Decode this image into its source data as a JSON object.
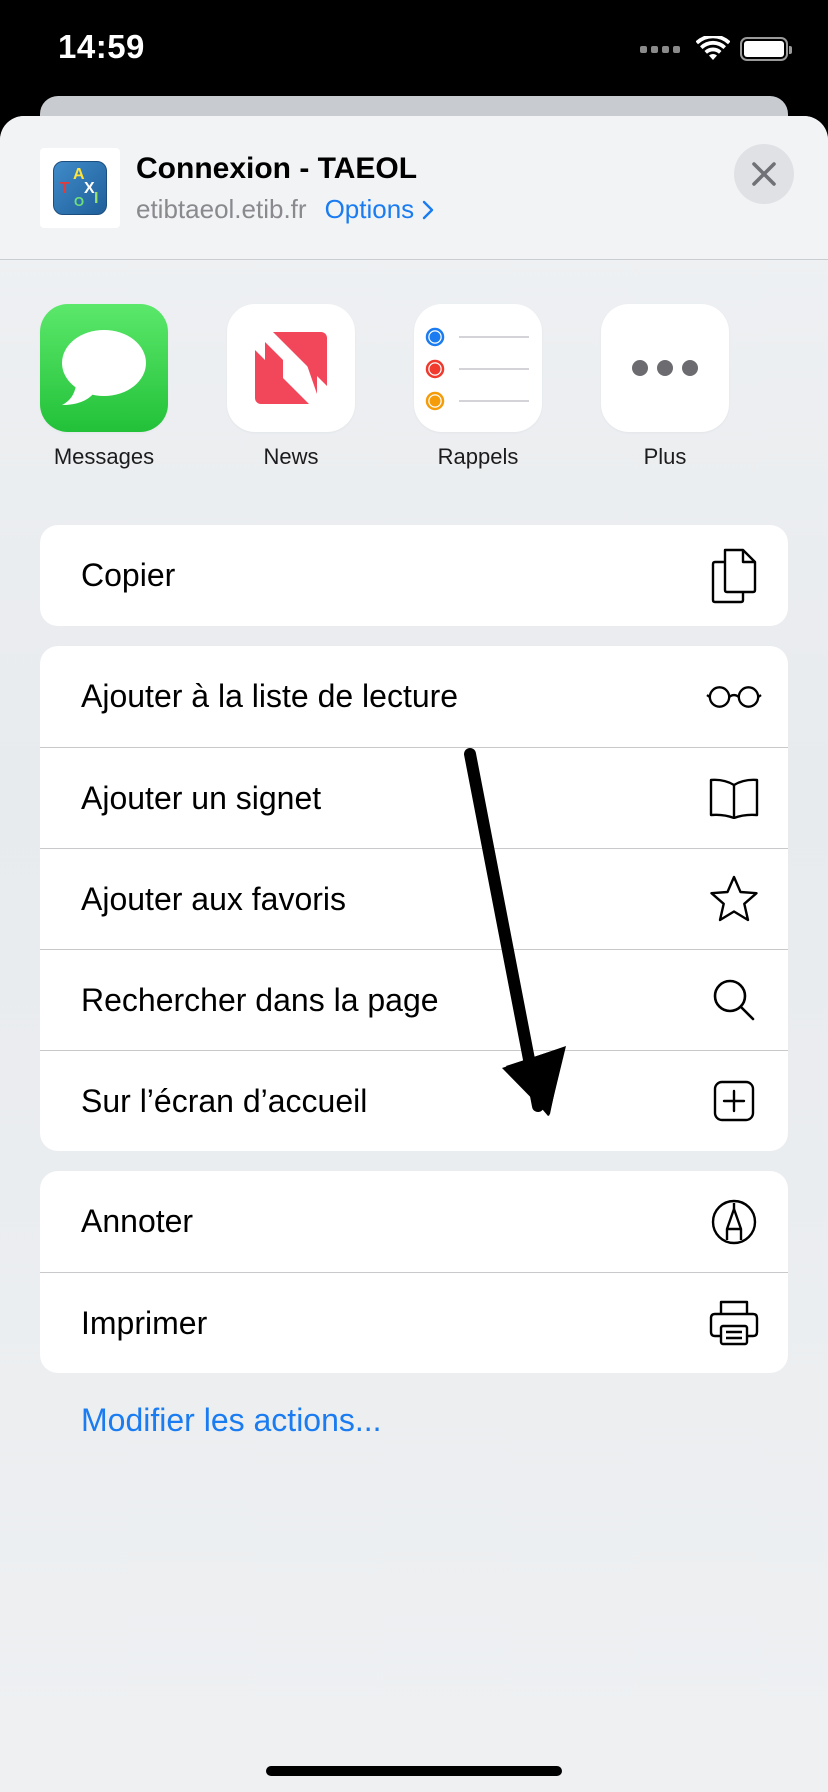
{
  "status": {
    "time": "14:59"
  },
  "header": {
    "title": "Connexion - TAEOL",
    "url": "etibtaeol.etib.fr",
    "options_label": "Options"
  },
  "apps": [
    {
      "label": "Messages",
      "icon": "messages-icon"
    },
    {
      "label": "News",
      "icon": "news-icon"
    },
    {
      "label": "Rappels",
      "icon": "reminders-icon"
    },
    {
      "label": "Plus",
      "icon": "more-icon"
    }
  ],
  "actions": {
    "copy": {
      "label": "Copier",
      "icon": "copy-icon"
    },
    "reading_list": {
      "label": "Ajouter à la liste de lecture",
      "icon": "glasses-icon"
    },
    "bookmark": {
      "label": "Ajouter un signet",
      "icon": "book-icon"
    },
    "favorites": {
      "label": "Ajouter aux favoris",
      "icon": "star-icon"
    },
    "find": {
      "label": "Rechercher dans la page",
      "icon": "search-icon"
    },
    "home_screen": {
      "label": "Sur l’écran d’accueil",
      "icon": "add-square-icon"
    },
    "markup": {
      "label": "Annoter",
      "icon": "markup-icon"
    },
    "print": {
      "label": "Imprimer",
      "icon": "printer-icon"
    }
  },
  "edit_actions_label": "Modifier les actions...",
  "colors": {
    "accent": "#1a7cf0",
    "messages_green": "#34c759",
    "news_red": "#f2475a",
    "reminder_blue": "#1a7cf0",
    "reminder_red": "#f03a2e",
    "reminder_orange": "#f59c0b"
  }
}
